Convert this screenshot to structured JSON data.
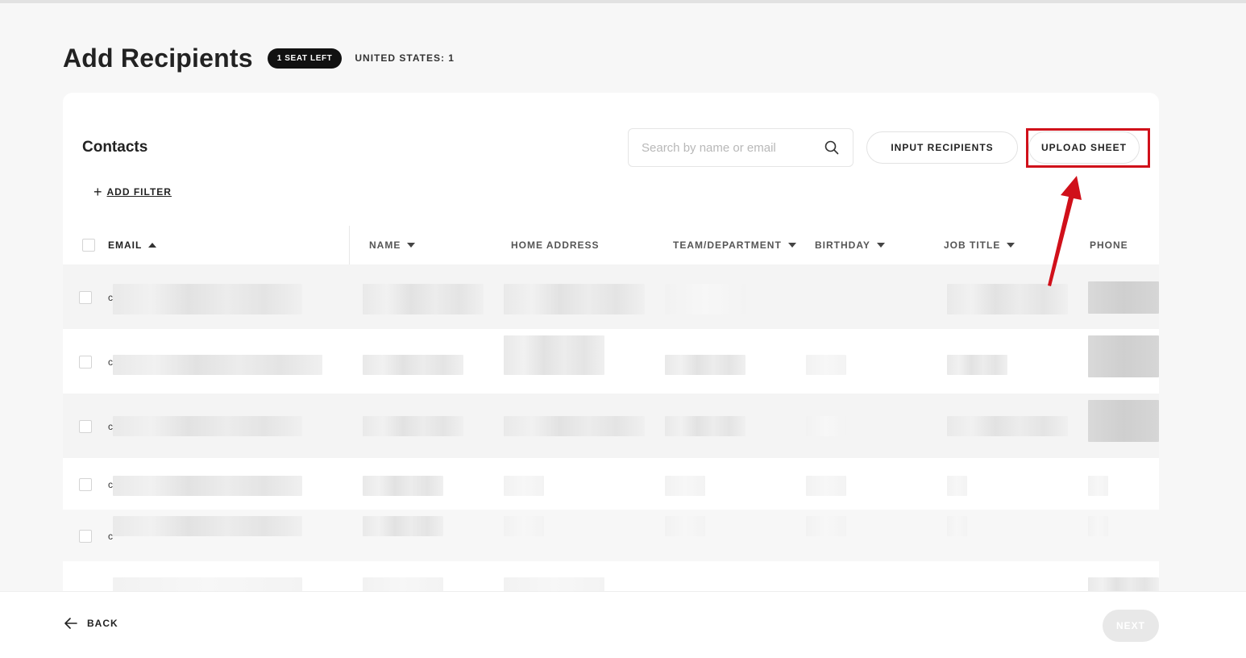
{
  "header": {
    "title": "Add Recipients",
    "seat_badge": "1 SEAT LEFT",
    "country_count": "UNITED STATES: 1"
  },
  "contacts": {
    "title": "Contacts",
    "search_placeholder": "Search by name or email",
    "input_recipients_label": "INPUT RECIPIENTS",
    "upload_sheet_label": "UPLOAD SHEET",
    "add_filter_label": "ADD FILTER"
  },
  "table": {
    "columns": [
      "EMAIL",
      "NAME",
      "HOME ADDRESS",
      "TEAM/DEPARTMENT",
      "BIRTHDAY",
      "JOB TITLE",
      "PHONE"
    ],
    "sort_column": "EMAIL",
    "sort_direction": "ascending",
    "row_prefix": "c",
    "rows_note_visible_count": 6
  },
  "footer": {
    "back_label": "BACK",
    "next_label": "NEXT"
  },
  "colors": {
    "accent_highlight": "#d0101a",
    "badge_bg": "#111111",
    "page_bg": "#f7f7f7"
  },
  "icons": [
    "search-icon",
    "plus-icon",
    "sort-up-icon",
    "sort-down-icon",
    "arrow-left-icon",
    "annotation-arrow-icon"
  ]
}
